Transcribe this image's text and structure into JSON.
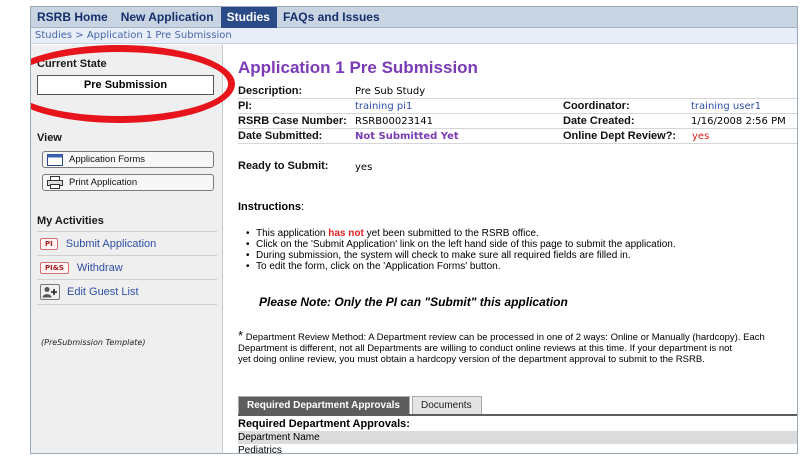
{
  "nav": {
    "tabs": [
      {
        "label": "RSRB Home"
      },
      {
        "label": "New Application"
      },
      {
        "label": "Studies"
      },
      {
        "label": "FAQs and Issues"
      }
    ]
  },
  "breadcrumb": {
    "text": "Studies  >  Application 1 Pre Submission"
  },
  "sidebar": {
    "current_state_heading": "Current State",
    "current_state_value": "Pre Submission",
    "view_heading": "View",
    "view_buttons": [
      {
        "label": "Application Forms",
        "icon": "form-icon"
      },
      {
        "label": "Print Application",
        "icon": "printer-icon"
      }
    ],
    "activities_heading": "My Activities",
    "activities": [
      {
        "badge": "PI",
        "label": "Submit Application"
      },
      {
        "badge": "PI&S",
        "label": "Withdraw"
      },
      {
        "badge": "",
        "label": "Edit Guest List",
        "icon": "add-user-icon"
      }
    ],
    "template_note": "(PreSubmission Template)"
  },
  "main": {
    "title": "Application 1 Pre Submission",
    "fields": {
      "description_label": "Description:",
      "description_value": "Pre Sub Study",
      "pi_label": "PI:",
      "pi_value": "training pi1",
      "coordinator_label": "Coordinator:",
      "coordinator_value": "training user1",
      "case_label": "RSRB Case Number:",
      "case_value": "RSRB00023141",
      "created_label": "Date Created:",
      "created_value": "1/16/2008 2:56 PM",
      "submitted_label": "Date Submitted:",
      "submitted_value": "Not Submitted Yet",
      "online_label": "Online Dept Review?:",
      "online_value": "yes",
      "ready_label": "Ready to Submit:",
      "ready_value": "yes"
    },
    "instructions_label": "Instructions",
    "bullets": {
      "b1_pre": "This application ",
      "b1_red": "has not",
      "b1_post": " yet been submitted to the RSRB office.",
      "b2": "Click on the 'Submit Application' link on the left hand side of this page to submit the application.",
      "b3": "During submission, the system will check to make sure all required fields are filled in.",
      "b4": "To edit the form, click on the 'Application Forms' button."
    },
    "pi_note": "Please Note: Only the PI can \"Submit\" this application",
    "dept_review": {
      "star": "*",
      "line1": " Department Review Method:  A Department review can be processed in one of 2 ways: Online or Manually (hardcopy). Each",
      "line2": "Department is different, not all Departments are willing to conduct online reviews at this time. If your department is not",
      "line3": "yet doing online review, you must obtain a hardcopy version of the department approval to submit to the RSRB."
    },
    "tabs": [
      {
        "label": "Required Department Approvals"
      },
      {
        "label": "Documents"
      }
    ],
    "required_label": "Required Department Approvals",
    "table": {
      "column": "Department Name",
      "rows": [
        "Pediatrics"
      ]
    }
  },
  "colors": {
    "nav_bg": "#c9d4e3",
    "nav_active": "#2a4a88",
    "title_purple": "#7b3ab6",
    "link_blue": "#2f4fa5",
    "highlight_red": "#e8141c"
  }
}
